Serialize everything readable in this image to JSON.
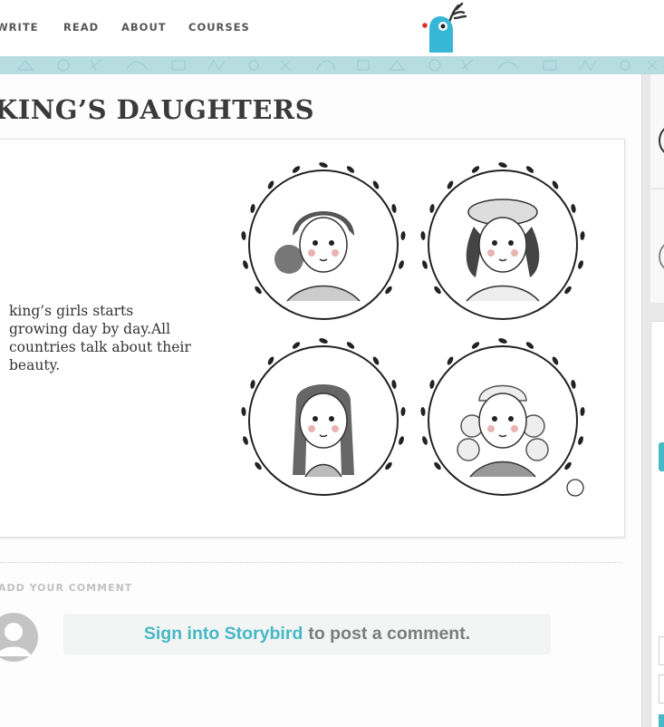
{
  "nav": {
    "items": [
      {
        "label": "WRITE"
      },
      {
        "label": "READ"
      },
      {
        "label": "ABOUT"
      },
      {
        "label": "COURSES"
      }
    ]
  },
  "post": {
    "title": "KING’S DAUGHTERS",
    "story_text": "king’s girls starts growing day by day.All countries talk about their beauty."
  },
  "comments": {
    "label": "ADD YOUR COMMENT",
    "signin_link": "Sign into Storybird",
    "signin_rest": "to post a comment."
  },
  "colors": {
    "accent": "#46b9c4",
    "pattern": "#b7dde0",
    "title": "#3a3a3a"
  }
}
